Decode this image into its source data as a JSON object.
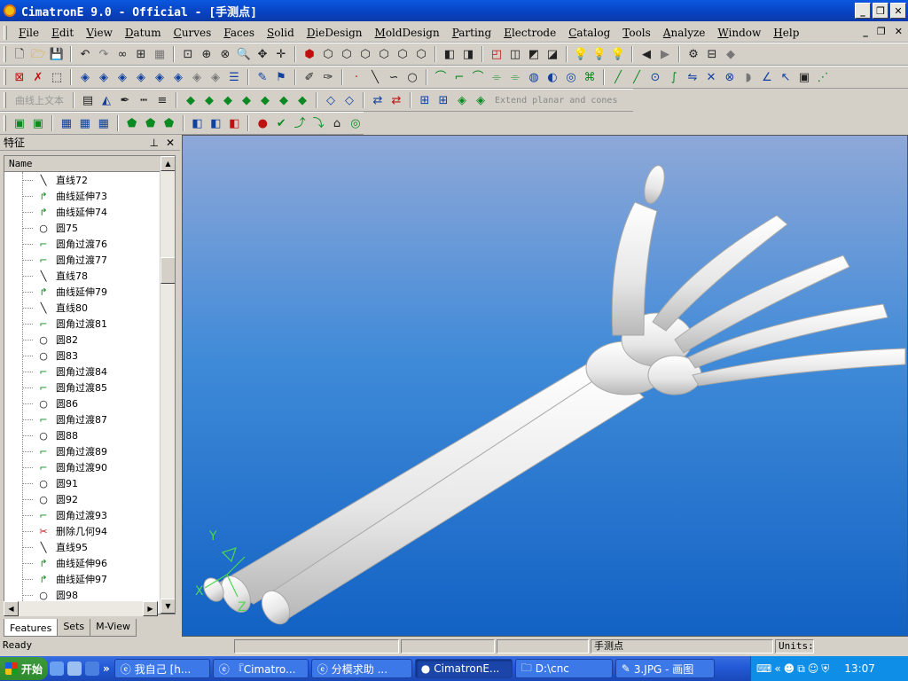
{
  "window": {
    "title": "CimatronE 9.0 - Official - [手测点]"
  },
  "menu": [
    "File",
    "Edit",
    "View",
    "Datum",
    "Curves",
    "Faces",
    "Solid",
    "DieDesign",
    "MoldDesign",
    "Parting",
    "Electrode",
    "Catalog",
    "Tools",
    "Analyze",
    "Window",
    "Help"
  ],
  "toolbar": {
    "curve_on_face": "曲线上文本",
    "extend_label": "Extend planar and cones"
  },
  "panel": {
    "title": "特征",
    "column": "Name",
    "tabs": [
      "Features",
      "Sets",
      "M-View"
    ],
    "rows": [
      {
        "icon": "line",
        "label": "直线72"
      },
      {
        "icon": "extend",
        "label": "曲线延伸73"
      },
      {
        "icon": "extend",
        "label": "曲线延伸74"
      },
      {
        "icon": "circle",
        "label": "圆75"
      },
      {
        "icon": "fillet",
        "label": "圆角过渡76"
      },
      {
        "icon": "fillet",
        "label": "圆角过渡77"
      },
      {
        "icon": "line",
        "label": "直线78"
      },
      {
        "icon": "extend",
        "label": "曲线延伸79"
      },
      {
        "icon": "line",
        "label": "直线80"
      },
      {
        "icon": "fillet",
        "label": "圆角过渡81"
      },
      {
        "icon": "circle",
        "label": "圆82"
      },
      {
        "icon": "circle",
        "label": "圆83"
      },
      {
        "icon": "fillet",
        "label": "圆角过渡84"
      },
      {
        "icon": "fillet",
        "label": "圆角过渡85"
      },
      {
        "icon": "circle",
        "label": "圆86"
      },
      {
        "icon": "fillet",
        "label": "圆角过渡87"
      },
      {
        "icon": "circle",
        "label": "圆88"
      },
      {
        "icon": "fillet",
        "label": "圆角过渡89"
      },
      {
        "icon": "fillet",
        "label": "圆角过渡90"
      },
      {
        "icon": "circle",
        "label": "圆91"
      },
      {
        "icon": "circle",
        "label": "圆92"
      },
      {
        "icon": "fillet",
        "label": "圆角过渡93"
      },
      {
        "icon": "delete",
        "label": "删除几何94"
      },
      {
        "icon": "line",
        "label": "直线95"
      },
      {
        "icon": "extend",
        "label": "曲线延伸96"
      },
      {
        "icon": "extend",
        "label": "曲线延伸97"
      },
      {
        "icon": "circle",
        "label": "圆98"
      }
    ]
  },
  "viewport": {
    "axis_y": "Y",
    "axis_x": "X",
    "axis_z": "Z"
  },
  "status": {
    "text": "Ready",
    "file": "手测点",
    "units": "Units:"
  },
  "taskbar": {
    "start": "开始",
    "tasks": [
      "我自己 [h...",
      "『Cimatro...",
      "分模求助 ...",
      "CimatronE...",
      "D:\\cnc",
      "3.JPG - 画图"
    ],
    "clock": "13:07"
  }
}
